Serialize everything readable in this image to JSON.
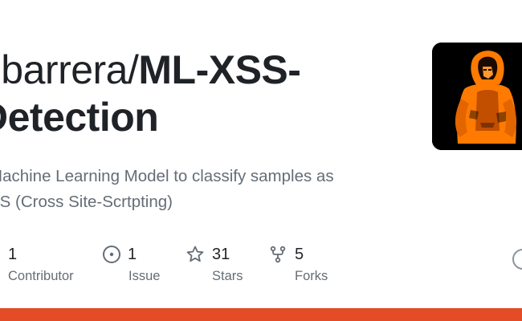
{
  "repo": {
    "owner_prefix": "obarrera/",
    "name_line1": "ML-XSS-",
    "name_line2": "Detection",
    "description_line1": "Machine Learning Model to classify samples as",
    "description_line2": "SS (Cross Site-Scrtpting)"
  },
  "stats": {
    "contributors": {
      "count": "1",
      "label": "Contributor",
      "icon": "people-icon"
    },
    "issues": {
      "count": "1",
      "label": "Issue",
      "icon": "issue-opened-icon"
    },
    "stars": {
      "count": "31",
      "label": "Stars",
      "icon": "star-icon"
    },
    "forks": {
      "count": "5",
      "label": "Forks",
      "icon": "repo-forked-icon"
    }
  },
  "colors": {
    "language_bar": "#e34c26",
    "title": "#1f2328",
    "muted": "#656d76",
    "avatar_figure": "#ff7a00"
  }
}
